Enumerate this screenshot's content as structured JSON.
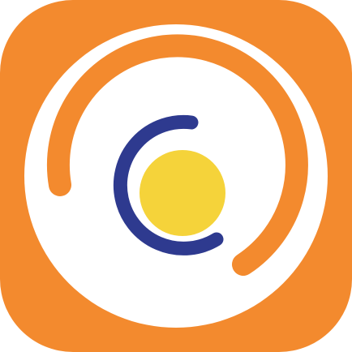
{
  "icon": {
    "name": "orbit-logo-icon",
    "colors": {
      "tile": "#F38A2E",
      "disc": "#FFFFFF",
      "orbit_arc": "#F38A2E",
      "crescent": "#2E3A8F",
      "sun": "#F5D33A"
    }
  }
}
